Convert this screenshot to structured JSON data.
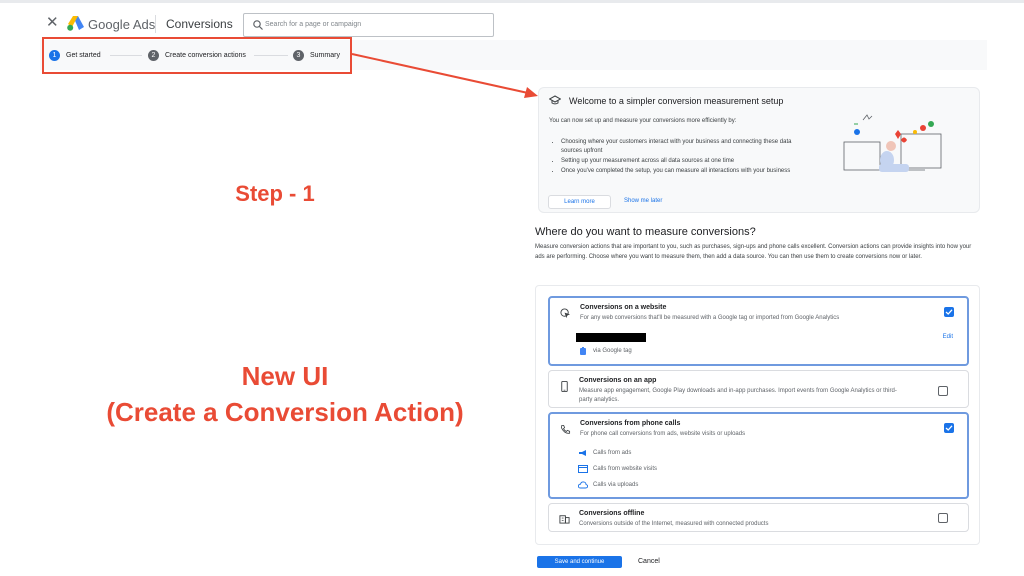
{
  "header": {
    "brand": "Google Ads",
    "page_title": "Conversions",
    "search_placeholder": "Search for a page or campaign"
  },
  "steps": [
    {
      "num": "1",
      "label": "Get started"
    },
    {
      "num": "2",
      "label": "Create conversion actions"
    },
    {
      "num": "3",
      "label": "Summary"
    }
  ],
  "annotations": {
    "step": "Step - 1",
    "new_ui_line1": "New UI",
    "new_ui_line2": "(Create a Conversion Action)"
  },
  "welcome": {
    "title": "Welcome to a simpler conversion measurement setup",
    "intro": "You can now set up and measure your conversions more efficiently by:",
    "bullets": [
      "Choosing where your customers interact with your business and connecting these data sources upfront",
      "Setting up your measurement across all data sources at one time",
      "Once you've completed the setup, you can measure all interactions with your business"
    ],
    "learn_more": "Learn more",
    "show_later": "Show me later"
  },
  "section": {
    "title": "Where do you want to measure conversions?",
    "description": "Measure conversion actions that are important to you, such as purchases, sign-ups and phone calls excellent. Conversion actions can provide insights into how your ads are performing. Choose where you want to measure them, then add a data source. You can then use them to create conversions now or later."
  },
  "options": {
    "website": {
      "title": "Conversions on a website",
      "desc": "For any web conversions that'll be measured with a Google tag or imported from Google Analytics",
      "checked": true,
      "edit": "Edit",
      "via": "via Google tag"
    },
    "app": {
      "title": "Conversions on an app",
      "desc": "Measure app engagement, Google Play downloads and in-app purchases. Import events from Google Analytics or third-party analytics.",
      "checked": false
    },
    "phone": {
      "title": "Conversions from phone calls",
      "desc": "For phone call conversions from ads, website visits or uploads",
      "checked": true,
      "subs": [
        "Calls from ads",
        "Calls from website visits",
        "Calls via uploads"
      ]
    },
    "offline": {
      "title": "Conversions offline",
      "desc": "Conversions outside of the Internet, measured with connected products",
      "checked": false
    }
  },
  "actions": {
    "save": "Save and continue",
    "cancel": "Cancel"
  },
  "colors": {
    "accent": "#1a73e8",
    "annotation": "#e94b35"
  }
}
